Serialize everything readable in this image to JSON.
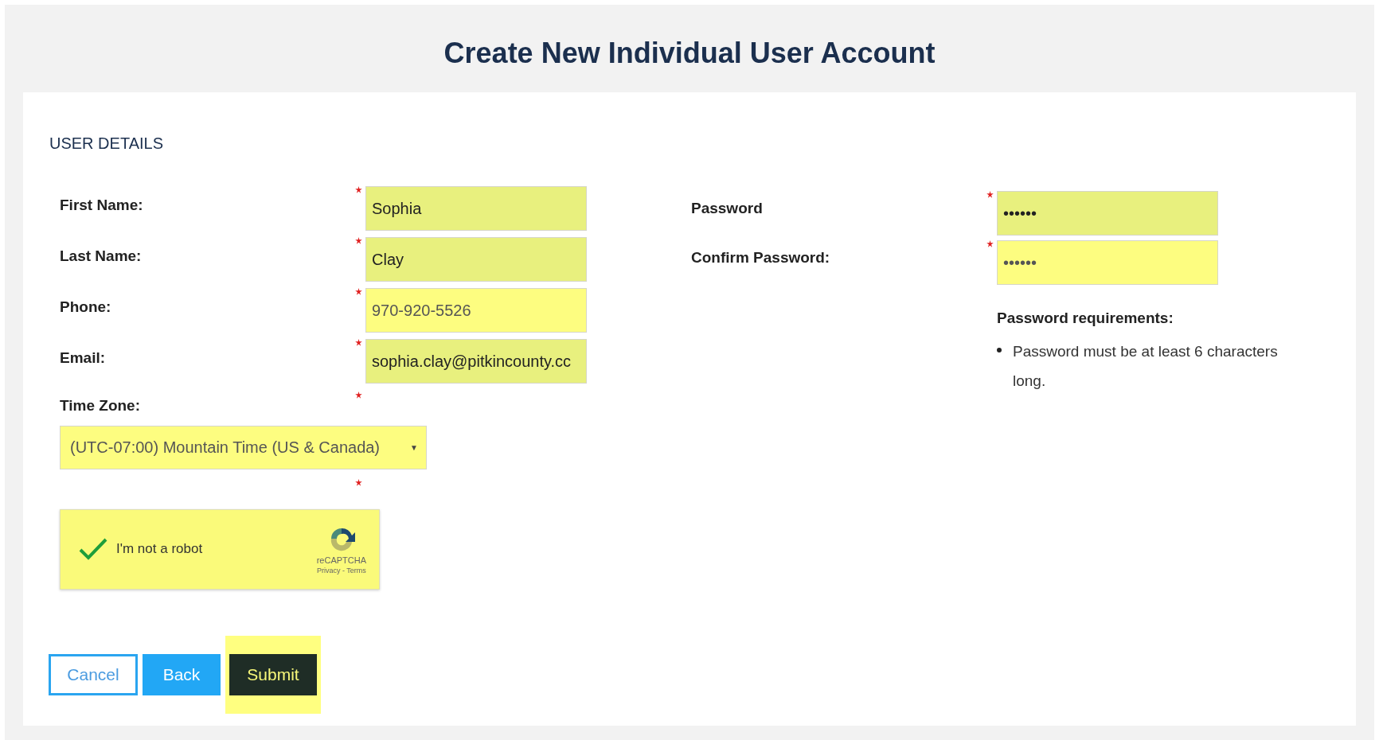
{
  "title": "Create New Individual User Account",
  "section_heading": "USER DETAILS",
  "left_fields": [
    {
      "label": "First Name:",
      "value": "Sophia",
      "required": true,
      "autofilled": true
    },
    {
      "label": "Last Name:",
      "value": "Clay",
      "required": true,
      "autofilled": true
    },
    {
      "label": "Phone:",
      "value": "970-920-5526",
      "required": true,
      "autofilled": false
    },
    {
      "label": "Email:",
      "value": "sophia.clay@pitkincounty.cc",
      "required": true,
      "autofilled": true
    }
  ],
  "time_zone": {
    "label": "Time Zone:",
    "required": true,
    "value": "(UTC-07:00) Mountain Time (US & Canada)",
    "caret": "▼"
  },
  "captcha": {
    "required": true,
    "checked": true,
    "label": "I'm not a robot",
    "brand": "reCAPTCHA",
    "links": "Privacy - Terms"
  },
  "buttons": [
    {
      "label": "Cancel",
      "kind": "outline",
      "highlighted": false
    },
    {
      "label": "Back",
      "kind": "primary",
      "highlighted": false
    },
    {
      "label": "Submit",
      "kind": "dark",
      "highlighted": true
    }
  ],
  "right_fields": [
    {
      "label": "Password",
      "value": "••••••",
      "required": true,
      "autofilled": true
    },
    {
      "label": "Confirm Password:",
      "value": "••••••",
      "required": true,
      "autofilled": false
    }
  ],
  "requirements": {
    "heading": "Password requirements:",
    "items": [
      "Password must be at least 6 characters long."
    ]
  }
}
